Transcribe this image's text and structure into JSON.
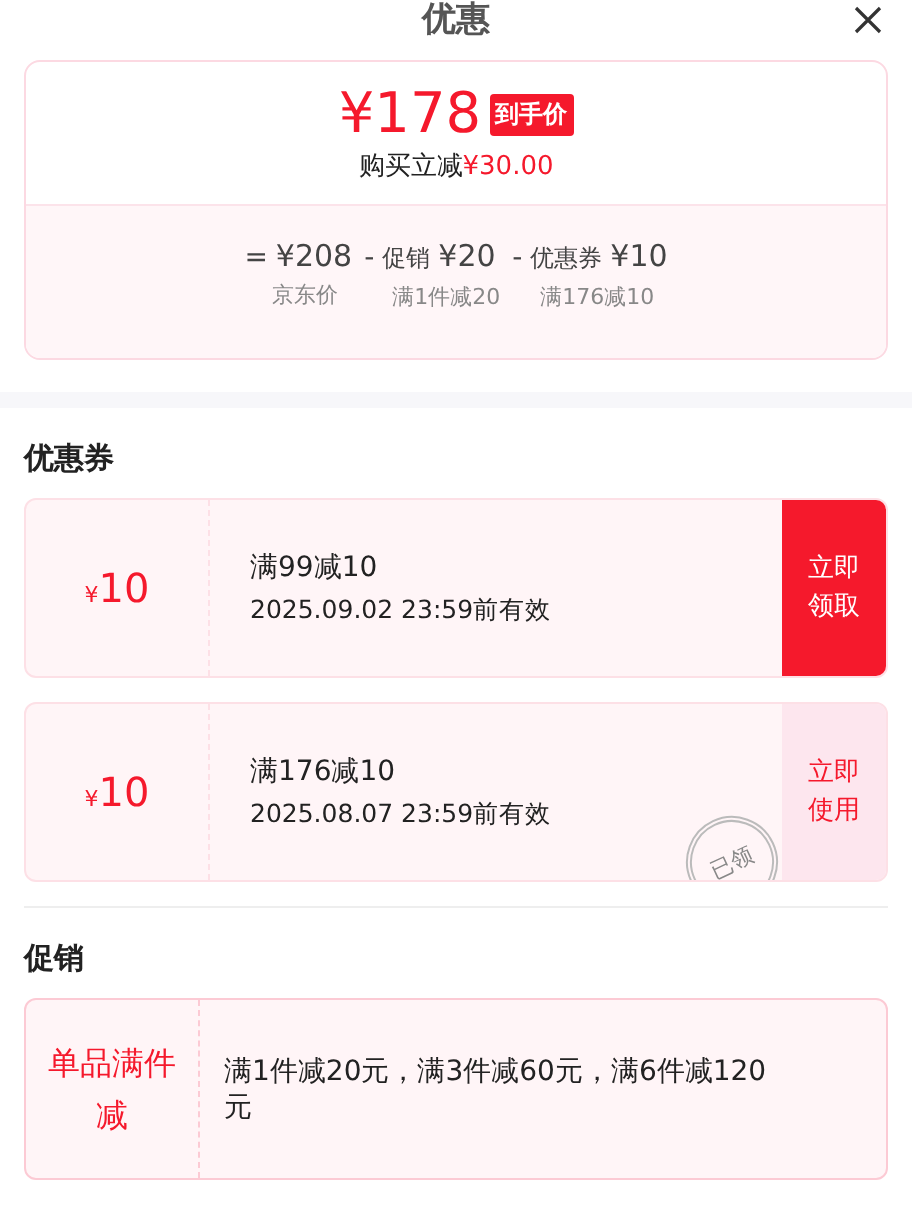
{
  "title": "优惠",
  "summary": {
    "price": "¥178",
    "price_tag": "到手价",
    "saving_label": "购买立减",
    "saving_amount": "¥30.00",
    "breakdown": [
      {
        "op": "=",
        "value": "¥208",
        "label": "京东价"
      },
      {
        "op": "-",
        "prefix": "促销",
        "value": "¥20",
        "label": "满1件减20"
      },
      {
        "op": "-",
        "prefix": "优惠券",
        "value": "¥10",
        "label": "满176减10"
      }
    ]
  },
  "coupons_heading": "优惠券",
  "coupons": [
    {
      "currency": "¥",
      "amount": "10",
      "condition": "满99减10",
      "validity": "2025.09.02 23:59前有效",
      "action": "立即领取",
      "claimed": false
    },
    {
      "currency": "¥",
      "amount": "10",
      "condition": "满176减10",
      "validity": "2025.08.07 23:59前有效",
      "action": "立即使用",
      "claimed": true,
      "stamp": "已领"
    }
  ],
  "promotions_heading": "促销",
  "promotions": [
    {
      "type": "单品满件减",
      "detail": "满1件减20元，满3件减60元，满6件减120元"
    }
  ]
}
